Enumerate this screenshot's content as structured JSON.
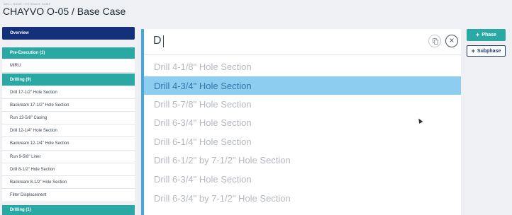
{
  "header": {
    "kicker": "WELL NAME / ESTIMATE NAME",
    "title": "CHAYVO O-05 / Base Case"
  },
  "sidebar": {
    "items": [
      {
        "label": "Overview",
        "kind": "overview"
      },
      {
        "label": "Pre-Execution (1)",
        "kind": "group"
      },
      {
        "label": "MIRU",
        "kind": "sub"
      },
      {
        "label": "Drilling (9)",
        "kind": "group"
      },
      {
        "label": "Drill 17-1/2\" Hole Section",
        "kind": "sub"
      },
      {
        "label": "Backream 17-1/2\" Hole Section",
        "kind": "sub"
      },
      {
        "label": "Run 13-5/8\" Casing",
        "kind": "sub"
      },
      {
        "label": "Drill 12-1/4\" Hole Section",
        "kind": "sub"
      },
      {
        "label": "Backream 12-1/4\" Hole Section",
        "kind": "sub"
      },
      {
        "label": "Run 9-5/8\" Liner",
        "kind": "sub"
      },
      {
        "label": "Drill 8-1/2\" Hole Section",
        "kind": "sub"
      },
      {
        "label": "Backream 8-1/2\" Hole Section",
        "kind": "sub"
      },
      {
        "label": "Filter Displacement",
        "kind": "sub"
      },
      {
        "label": "Drilling (1)",
        "kind": "group"
      }
    ]
  },
  "search": {
    "value": "D",
    "copy_icon": "copy-icon",
    "close_icon": "close-icon",
    "close_glyph": "×"
  },
  "options": [
    {
      "label": "Drill 4-1/8\" Hole Section",
      "selected": false
    },
    {
      "label": "Drill 4-3/4\" Hole Section",
      "selected": true
    },
    {
      "label": "Drill 5-7/8\" Hole Section",
      "selected": false
    },
    {
      "label": "Drill 6-3/4\" Hole Section",
      "selected": false
    },
    {
      "label": "Drill 6-1/4\" Hole Section",
      "selected": false
    },
    {
      "label": "Drill 6-1/2\" by 7-1/2\" Hole Section",
      "selected": false
    },
    {
      "label": "Drill 6-3/4\" Hole Section",
      "selected": false
    },
    {
      "label": "Drill 6-3/4\" by 7-1/2\" Hole Section",
      "selected": false
    }
  ],
  "actions": {
    "plus_glyph": "+",
    "phase_label": "Phase",
    "subphase_label": "Subphase"
  },
  "colors": {
    "navy": "#14307a",
    "teal": "#2aa8a4",
    "highlight": "#8ccdf0",
    "accent_border": "#46a6de"
  }
}
